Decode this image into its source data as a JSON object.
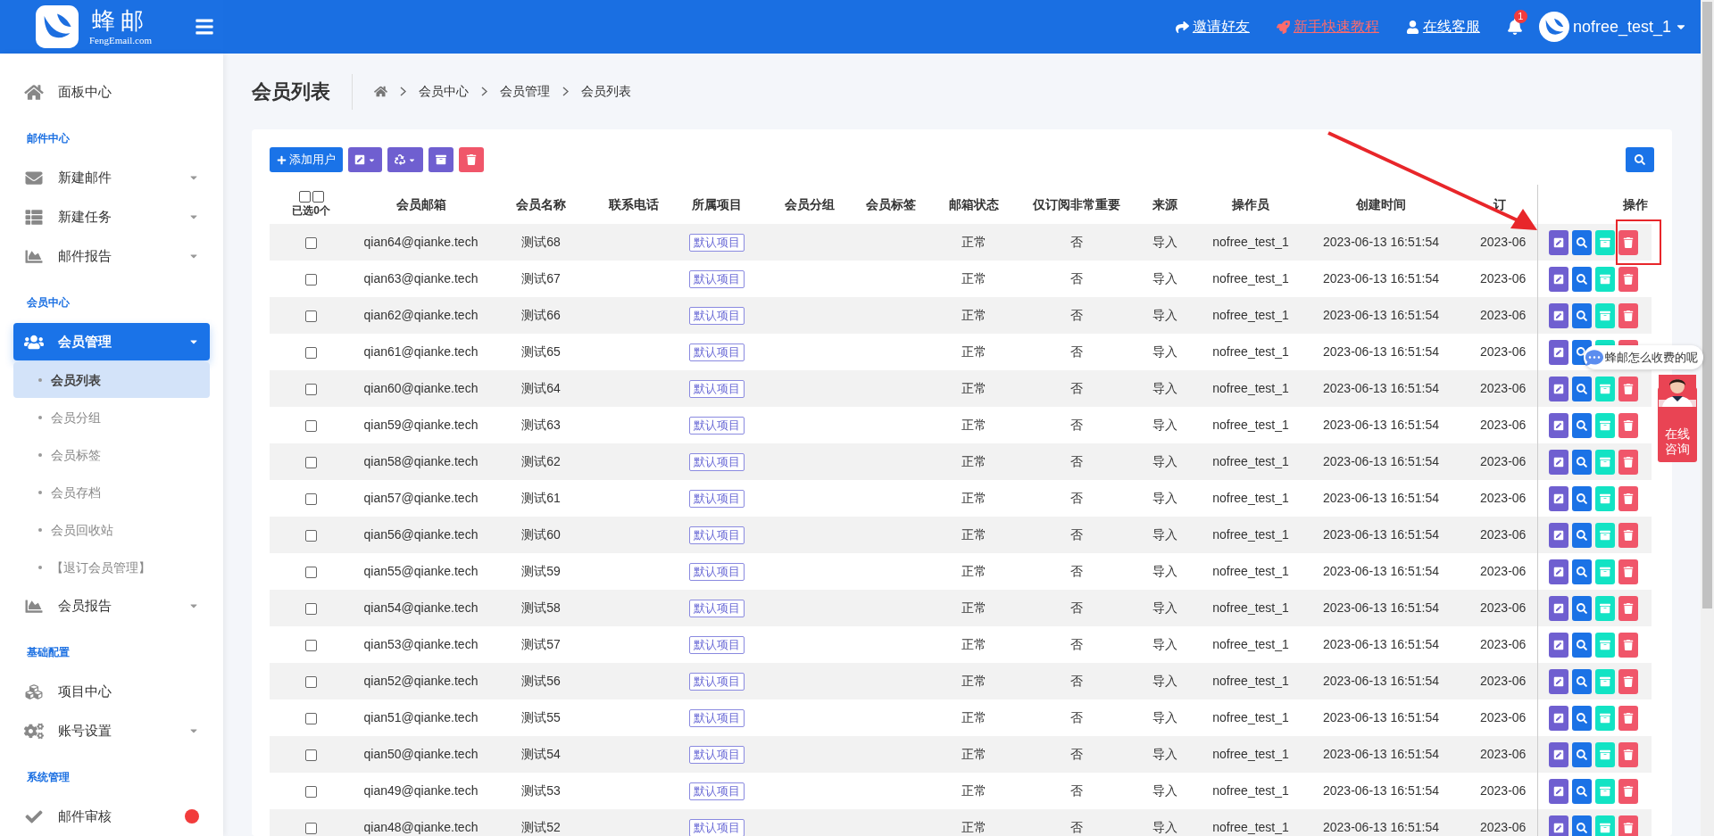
{
  "header": {
    "logo_title": "蜂邮",
    "logo_subtitle": "FengEmail.com",
    "links": [
      {
        "label": "邀请好友",
        "highlighted": false
      },
      {
        "label": "新手快速教程",
        "highlighted": true
      },
      {
        "label": "在线客服",
        "highlighted": false
      }
    ],
    "notification_count": "1",
    "username": "nofree_test_1"
  },
  "sidebar": {
    "sections": [
      {
        "items": [
          {
            "label": "面板中心",
            "expandable": false,
            "selected": false
          }
        ]
      },
      {
        "title": "邮件中心",
        "items": [
          {
            "label": "新建邮件",
            "expandable": true,
            "selected": false
          },
          {
            "label": "新建任务",
            "expandable": true,
            "selected": false
          },
          {
            "label": "邮件报告",
            "expandable": true,
            "selected": false
          }
        ]
      },
      {
        "title": "会员中心",
        "items": [
          {
            "label": "会员管理",
            "expandable": true,
            "selected": true,
            "children": [
              {
                "label": "会员列表",
                "selected": true
              },
              {
                "label": "会员分组",
                "selected": false
              },
              {
                "label": "会员标签",
                "selected": false
              },
              {
                "label": "会员存档",
                "selected": false
              },
              {
                "label": "会员回收站",
                "selected": false
              },
              {
                "label": "【退订会员管理】",
                "selected": false
              }
            ]
          },
          {
            "label": "会员报告",
            "expandable": true,
            "selected": false
          }
        ]
      },
      {
        "title": "基础配置",
        "items": [
          {
            "label": "项目中心",
            "expandable": false,
            "selected": false
          },
          {
            "label": "账号设置",
            "expandable": true,
            "selected": false
          }
        ]
      },
      {
        "title": "系统管理",
        "items": [
          {
            "label": "邮件审核",
            "expandable": false,
            "selected": false,
            "badge": true
          }
        ]
      }
    ]
  },
  "page": {
    "title": "会员列表",
    "breadcrumb": [
      "会员中心",
      "会员管理",
      "会员列表"
    ]
  },
  "toolbar": {
    "add_button": "添加用户"
  },
  "table": {
    "select_all": {
      "checkboxes": [
        {
          "checked": false
        },
        {
          "checked": false
        }
      ],
      "label": "已选0个"
    },
    "columns": [
      "会员邮箱",
      "会员名称",
      "联系电话",
      "所属项目",
      "会员分组",
      "会员标签",
      "邮箱状态",
      "仅订阅非常重要",
      "来源",
      "操作员",
      "创建时间",
      "订",
      "操作"
    ],
    "rows": [
      {
        "selected": false,
        "email": "qian64@qianke.tech",
        "name": "测试68",
        "project": "默认项目",
        "status": "正常",
        "important_only": "否",
        "source": "导入",
        "operator": "nofree_test_1",
        "created": "2023-06-13 16:51:54",
        "column_13": "2023-06"
      },
      {
        "selected": false,
        "email": "qian63@qianke.tech",
        "name": "测试67",
        "project": "默认项目",
        "status": "正常",
        "important_only": "否",
        "source": "导入",
        "operator": "nofree_test_1",
        "created": "2023-06-13 16:51:54",
        "column_13": "2023-06"
      },
      {
        "selected": false,
        "email": "qian62@qianke.tech",
        "name": "测试66",
        "project": "默认项目",
        "status": "正常",
        "important_only": "否",
        "source": "导入",
        "operator": "nofree_test_1",
        "created": "2023-06-13 16:51:54",
        "column_13": "2023-06"
      },
      {
        "selected": false,
        "email": "qian61@qianke.tech",
        "name": "测试65",
        "project": "默认项目",
        "status": "正常",
        "important_only": "否",
        "source": "导入",
        "operator": "nofree_test_1",
        "created": "2023-06-13 16:51:54",
        "column_13": "2023-06"
      },
      {
        "selected": false,
        "email": "qian60@qianke.tech",
        "name": "测试64",
        "project": "默认项目",
        "status": "正常",
        "important_only": "否",
        "source": "导入",
        "operator": "nofree_test_1",
        "created": "2023-06-13 16:51:54",
        "column_13": "2023-06"
      },
      {
        "selected": false,
        "email": "qian59@qianke.tech",
        "name": "测试63",
        "project": "默认项目",
        "status": "正常",
        "important_only": "否",
        "source": "导入",
        "operator": "nofree_test_1",
        "created": "2023-06-13 16:51:54",
        "column_13": "2023-06"
      },
      {
        "selected": false,
        "email": "qian58@qianke.tech",
        "name": "测试62",
        "project": "默认项目",
        "status": "正常",
        "important_only": "否",
        "source": "导入",
        "operator": "nofree_test_1",
        "created": "2023-06-13 16:51:54",
        "column_13": "2023-06"
      },
      {
        "selected": false,
        "email": "qian57@qianke.tech",
        "name": "测试61",
        "project": "默认项目",
        "status": "正常",
        "important_only": "否",
        "source": "导入",
        "operator": "nofree_test_1",
        "created": "2023-06-13 16:51:54",
        "column_13": "2023-06"
      },
      {
        "selected": false,
        "email": "qian56@qianke.tech",
        "name": "测试60",
        "project": "默认项目",
        "status": "正常",
        "important_only": "否",
        "source": "导入",
        "operator": "nofree_test_1",
        "created": "2023-06-13 16:51:54",
        "column_13": "2023-06"
      },
      {
        "selected": false,
        "email": "qian55@qianke.tech",
        "name": "测试59",
        "project": "默认项目",
        "status": "正常",
        "important_only": "否",
        "source": "导入",
        "operator": "nofree_test_1",
        "created": "2023-06-13 16:51:54",
        "column_13": "2023-06"
      },
      {
        "selected": false,
        "email": "qian54@qianke.tech",
        "name": "测试58",
        "project": "默认项目",
        "status": "正常",
        "important_only": "否",
        "source": "导入",
        "operator": "nofree_test_1",
        "created": "2023-06-13 16:51:54",
        "column_13": "2023-06"
      },
      {
        "selected": false,
        "email": "qian53@qianke.tech",
        "name": "测试57",
        "project": "默认项目",
        "status": "正常",
        "important_only": "否",
        "source": "导入",
        "operator": "nofree_test_1",
        "created": "2023-06-13 16:51:54",
        "column_13": "2023-06"
      },
      {
        "selected": false,
        "email": "qian52@qianke.tech",
        "name": "测试56",
        "project": "默认项目",
        "status": "正常",
        "important_only": "否",
        "source": "导入",
        "operator": "nofree_test_1",
        "created": "2023-06-13 16:51:54",
        "column_13": "2023-06"
      },
      {
        "selected": false,
        "email": "qian51@qianke.tech",
        "name": "测试55",
        "project": "默认项目",
        "status": "正常",
        "important_only": "否",
        "source": "导入",
        "operator": "nofree_test_1",
        "created": "2023-06-13 16:51:54",
        "column_13": "2023-06"
      },
      {
        "selected": false,
        "email": "qian50@qianke.tech",
        "name": "测试54",
        "project": "默认项目",
        "status": "正常",
        "important_only": "否",
        "source": "导入",
        "operator": "nofree_test_1",
        "created": "2023-06-13 16:51:54",
        "column_13": "2023-06"
      },
      {
        "selected": false,
        "email": "qian49@qianke.tech",
        "name": "测试53",
        "project": "默认项目",
        "status": "正常",
        "important_only": "否",
        "source": "导入",
        "operator": "nofree_test_1",
        "created": "2023-06-13 16:51:54",
        "column_13": "2023-06"
      },
      {
        "selected": false,
        "email": "qian48@qianke.tech",
        "name": "测试52",
        "project": "默认项目",
        "status": "正常",
        "important_only": "否",
        "source": "导入",
        "operator": "nofree_test_1",
        "created": "2023-06-13 16:51:54",
        "column_13": "2023-06"
      }
    ]
  },
  "float": {
    "chat_prompt": "蜂邮怎么收费的呢",
    "consult_label": "在线咨询"
  }
}
